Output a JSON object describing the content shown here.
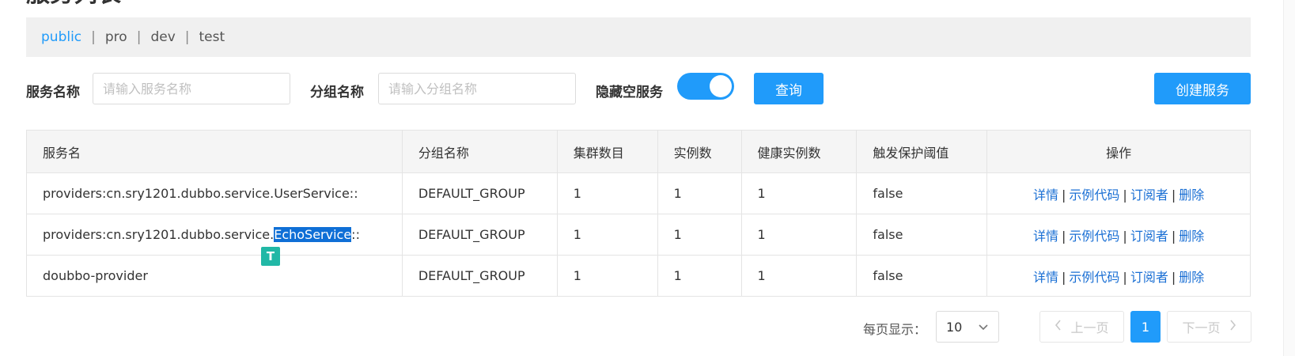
{
  "page": {
    "title": "服务列表"
  },
  "namespaces": {
    "items": [
      "public",
      "pro",
      "dev",
      "test"
    ],
    "active": "public"
  },
  "filters": {
    "service_name_label": "服务名称",
    "service_name_placeholder": "请输入服务名称",
    "group_name_label": "分组名称",
    "group_name_placeholder": "请输入分组名称",
    "hide_empty_label": "隐藏空服务",
    "hide_empty_on": true,
    "query_button": "查询",
    "create_button": "创建服务"
  },
  "table": {
    "columns": [
      "服务名",
      "分组名称",
      "集群数目",
      "实例数",
      "健康实例数",
      "触发保护阈值",
      "操作"
    ],
    "rows": [
      {
        "service": "providers:cn.sry1201.dubbo.service.UserService::",
        "group": "DEFAULT_GROUP",
        "clusters": "1",
        "instances": "1",
        "healthy": "1",
        "threshold": "false"
      },
      {
        "service_prefix": "providers:cn.sry1201.dubbo.service.",
        "service_selected": "EchoService",
        "service_suffix": "::",
        "group": "DEFAULT_GROUP",
        "clusters": "1",
        "instances": "1",
        "healthy": "1",
        "threshold": "false"
      },
      {
        "service": "doubbo-provider",
        "group": "DEFAULT_GROUP",
        "clusters": "1",
        "instances": "1",
        "healthy": "1",
        "threshold": "false"
      }
    ],
    "ops": {
      "detail": "详情",
      "sample": "示例代码",
      "subscribers": "订阅者",
      "delete": "删除",
      "sep": "|"
    }
  },
  "translate_badge": "T",
  "pagination": {
    "page_size_label": "每页显示：",
    "page_size": "10",
    "prev": "上一页",
    "next": "下一页",
    "current": "1"
  },
  "colors": {
    "accent": "#209bfa",
    "link": "#1a6fd4",
    "selection": "#0f6fd6",
    "badge": "#21b8a6"
  }
}
